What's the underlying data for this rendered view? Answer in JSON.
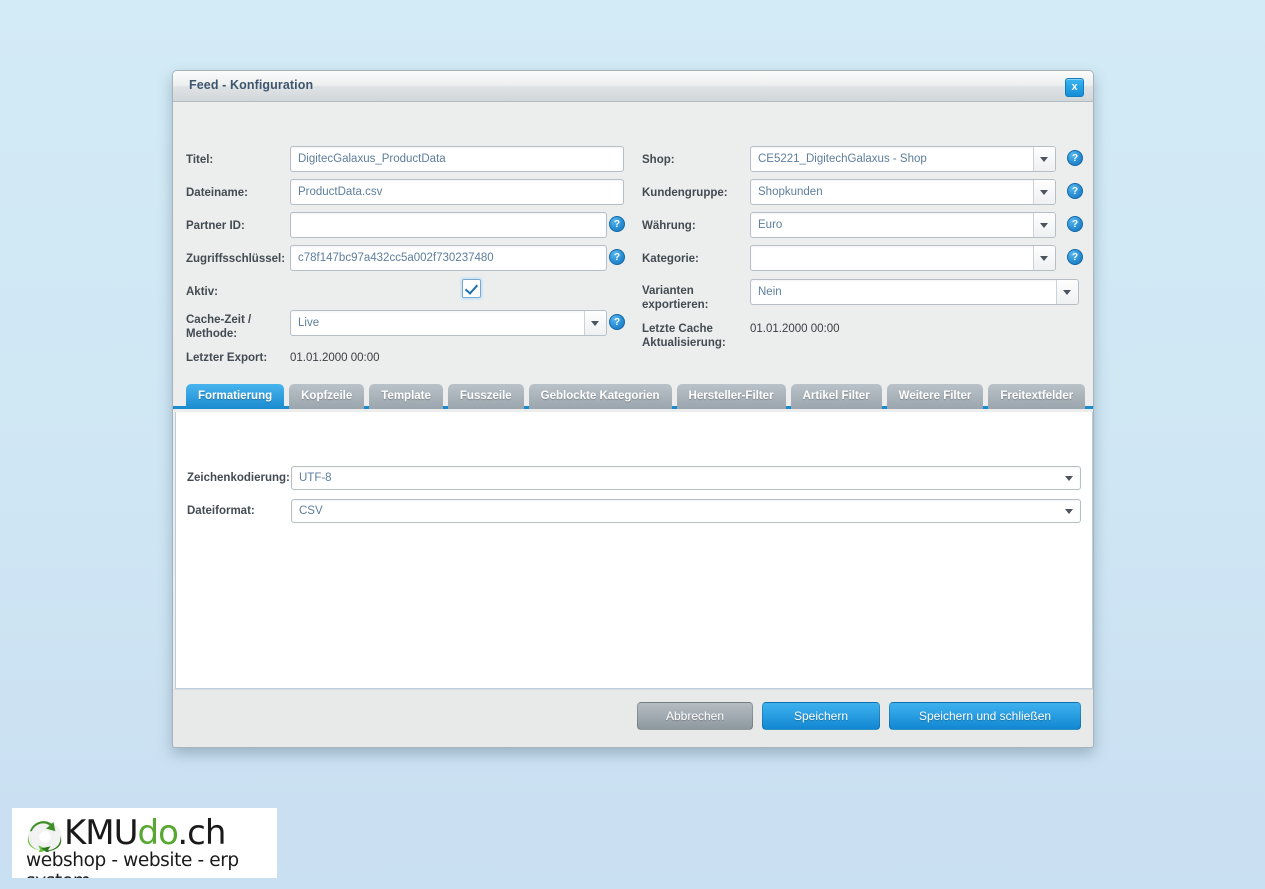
{
  "dialog": {
    "title": "Feed - Konfiguration",
    "close_label": "x"
  },
  "form": {
    "left": {
      "titel_label": "Titel:",
      "titel_value": "DigitecGalaxus_ProductData",
      "dateiname_label": "Dateiname:",
      "dateiname_value": "ProductData.csv",
      "partner_id_label": "Partner ID:",
      "partner_id_value": "",
      "zugriffsschluessel_label": "Zugriffsschlüssel:",
      "zugriffsschluessel_value": "c78f147bc97a432cc5a002f730237480",
      "aktiv_label": "Aktiv:",
      "aktiv_checked": true,
      "cache_zeit_label": "Cache-Zeit / Methode:",
      "cache_zeit_value": "Live",
      "letzter_export_label": "Letzter Export:",
      "letzter_export_value": "01.01.2000 00:00"
    },
    "right": {
      "shop_label": "Shop:",
      "shop_value": "CE5221_DigitechGalaxus - Shop",
      "kundengruppe_label": "Kundengruppe:",
      "kundengruppe_value": "Shopkunden",
      "waehrung_label": "Währung:",
      "waehrung_value": "Euro",
      "kategorie_label": "Kategorie:",
      "kategorie_value": "",
      "varianten_label": "Varianten exportieren:",
      "varianten_value": "Nein",
      "letzte_cache_label": "Letzte Cache Aktualisierung:",
      "letzte_cache_value": "01.01.2000 00:00"
    },
    "help_icon_label": "?"
  },
  "tabs": [
    {
      "label": "Formatierung",
      "active": true
    },
    {
      "label": "Kopfzeile",
      "active": false
    },
    {
      "label": "Template",
      "active": false
    },
    {
      "label": "Fusszeile",
      "active": false
    },
    {
      "label": "Geblockte Kategorien",
      "active": false
    },
    {
      "label": "Hersteller-Filter",
      "active": false
    },
    {
      "label": "Artikel Filter",
      "active": false
    },
    {
      "label": "Weitere Filter",
      "active": false
    },
    {
      "label": "Freitextfelder",
      "active": false
    }
  ],
  "panel": {
    "zeichenkodierung_label": "Zeichenkodierung:",
    "zeichenkodierung_value": "UTF-8",
    "dateiformat_label": "Dateiformat:",
    "dateiformat_value": "CSV"
  },
  "footer": {
    "cancel_label": "Abbrechen",
    "save_label": "Speichern",
    "save_close_label": "Speichern und schließen"
  },
  "logo": {
    "word_part1": "KMU",
    "word_part2": "do",
    "word_part3": ".ch",
    "tagline": "webshop - website - erp system"
  },
  "colors": {
    "accent_blue": "#1b8bd0",
    "tab_inactive": "#9ba5ad",
    "page_background": "#cfe6f4",
    "logo_green": "#56a830"
  }
}
